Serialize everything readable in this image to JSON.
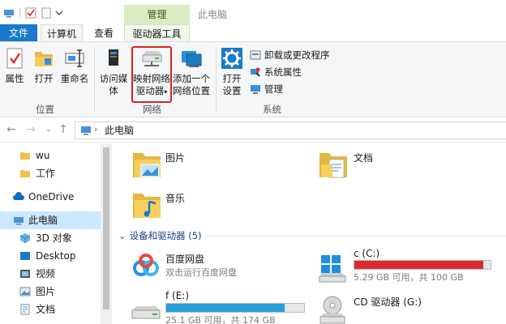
{
  "titlebar": {
    "manage_tab": "管理",
    "window_title": "此电脑"
  },
  "tabs": {
    "file": "文件",
    "computer": "计算机",
    "view": "查看",
    "drive_tools": "驱动器工具"
  },
  "ribbon": {
    "location": {
      "properties": "属性",
      "open": "打开",
      "rename": "重命名",
      "label": "位置"
    },
    "network": {
      "access_media": "访问媒体",
      "map_drive_line1": "映射网络",
      "map_drive_line2": "驱动器",
      "add_location_line1": "添加一个",
      "add_location_line2": "网络位置",
      "label": "网络"
    },
    "system": {
      "open_settings_line1": "打开",
      "open_settings_line2": "设置",
      "uninstall": "卸载或更改程序",
      "system_properties": "系统属性",
      "manage": "管理",
      "label": "系统"
    }
  },
  "address": {
    "path": "此电脑"
  },
  "sidebar": {
    "items": [
      {
        "label": "wu"
      },
      {
        "label": "工作"
      },
      {
        "label": "OneDrive"
      },
      {
        "label": "此电脑"
      },
      {
        "label": "3D 对象"
      },
      {
        "label": "Desktop"
      },
      {
        "label": "视频"
      },
      {
        "label": "图片"
      },
      {
        "label": "文档"
      }
    ]
  },
  "folders": [
    {
      "name": "图片"
    },
    {
      "name": "文档"
    },
    {
      "name": "音乐"
    }
  ],
  "devices_section": {
    "title": "设备和驱动器 (5)"
  },
  "drives": [
    {
      "name": "百度网盘",
      "sub": "双击运行百度网盘"
    },
    {
      "name": "c (C:)",
      "sub": "5.29 GB 可用，共 100 GB",
      "used_fraction": 0.947,
      "color": "#da2b2b"
    },
    {
      "name": "f (E:)",
      "sub": "25.1 GB 可用，共 174 GB",
      "used_fraction": 0.856,
      "color": "#26a0da"
    },
    {
      "name": "CD 驱动器 (G:)"
    }
  ],
  "colors": {
    "accent": "#1979ca",
    "manage_tab_bg": "#d8ecc3",
    "selected_item_bg": "#cce8ff",
    "highlight_box": "#e0201b"
  }
}
